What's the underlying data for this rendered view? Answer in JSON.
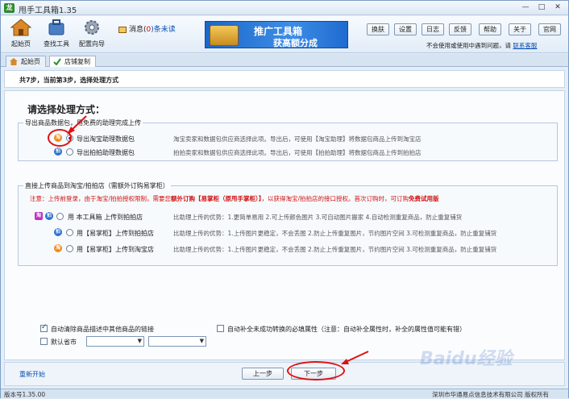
{
  "window": {
    "logo": "龙",
    "title": "甩手工具箱1.35",
    "controls": {
      "minimize": "—",
      "restore": "□",
      "close": "✕"
    }
  },
  "toolbar": {
    "home": "起始页",
    "find_tools": "查找工具",
    "config_wizard": "配置向导",
    "messages_label": "消息(",
    "messages_count": "0",
    "messages_unread": ")条未读",
    "banner_line1": "推广工具箱",
    "banner_line2": "获高额分成",
    "buttons": [
      "换肤",
      "设置",
      "日志",
      "反馈",
      "帮助",
      "关于",
      "官网"
    ],
    "notice": "不会使用或使用中遇到问题，请",
    "notice_link": "联系客服"
  },
  "tabs": [
    {
      "label": "起始页"
    },
    {
      "label": "店铺复制"
    }
  ],
  "step": {
    "text": "共7步，当前第3步，选择处理方式"
  },
  "main": {
    "heading": "请选择处理方式：",
    "group1": {
      "legend": "导出商品数据包，用免费的助理完成上传",
      "options": [
        {
          "label": "导出淘宝助理数据包",
          "desc": "淘宝卖家和数据包供应商选择此项。导出后，可使用【淘宝助理】将数据包商品上传到淘宝店",
          "checked": true
        },
        {
          "label": "导出拍拍助理数据包",
          "desc": "拍拍卖家和数据包供应商选择此项。导出后，可使用【拍拍助理】将数据包商品上传到拍拍店",
          "checked": false
        }
      ]
    },
    "group2": {
      "legend": "直接上传商品到淘宝/拍拍店（需额外订购易掌柜）",
      "warn_prefix": "注意：上传前登录，由于淘宝/拍拍授权限制，需要您",
      "warn_hl": "额外订购【易掌柜（原甩手掌柜）】",
      "warn_suffix": "，以获得淘宝/拍拍店的接口授权。首次订购时，可订购",
      "warn_free": "免费试用版",
      "options": [
        {
          "badge1": "淘",
          "badge2": "拍",
          "label": "用 本工具箱 上传到拍拍店",
          "desc": "比助理上传的优势：1.更简单易用 2.可上传颜色图片 3.可自动图片搬家 4.自动检测重复商品，防止重复铺货"
        },
        {
          "badge1": "拍",
          "label": "用【易掌柜】上传到拍拍店",
          "desc": "比助理上传的优势：1.上传图片更稳定，不会丢图 2.防止上传重复图片，节约图片空间 3.可检测重复商品，防止重复铺货"
        },
        {
          "badge1": "淘",
          "label": "用【易掌柜】上传到淘宝店",
          "desc": "比助理上传的优势：1.上传图片更稳定，不会丢图 2.防止上传重复图片，节约图片空间 3.可检测重复商品，防止重复铺货"
        }
      ]
    },
    "opt_remove_links": "自动清除商品描述中其他商品的链接",
    "opt_auto_fill": "自动补全未成功转换的必填属性（注意：自动补全属性时，补全的属性值可能有错）",
    "opt_default_province": "默认省市"
  },
  "bottom": {
    "restart": "重新开始",
    "prev": "上一步",
    "next": "下一步"
  },
  "status": {
    "version": "版本号1.35.00",
    "copyright": "深圳市华通易点信息技术有限公司 版权所有"
  },
  "watermark": "Baidu经验",
  "colors": {
    "accent": "#0a4fb0",
    "warn": "#d01010",
    "annotation": "#e01010"
  }
}
